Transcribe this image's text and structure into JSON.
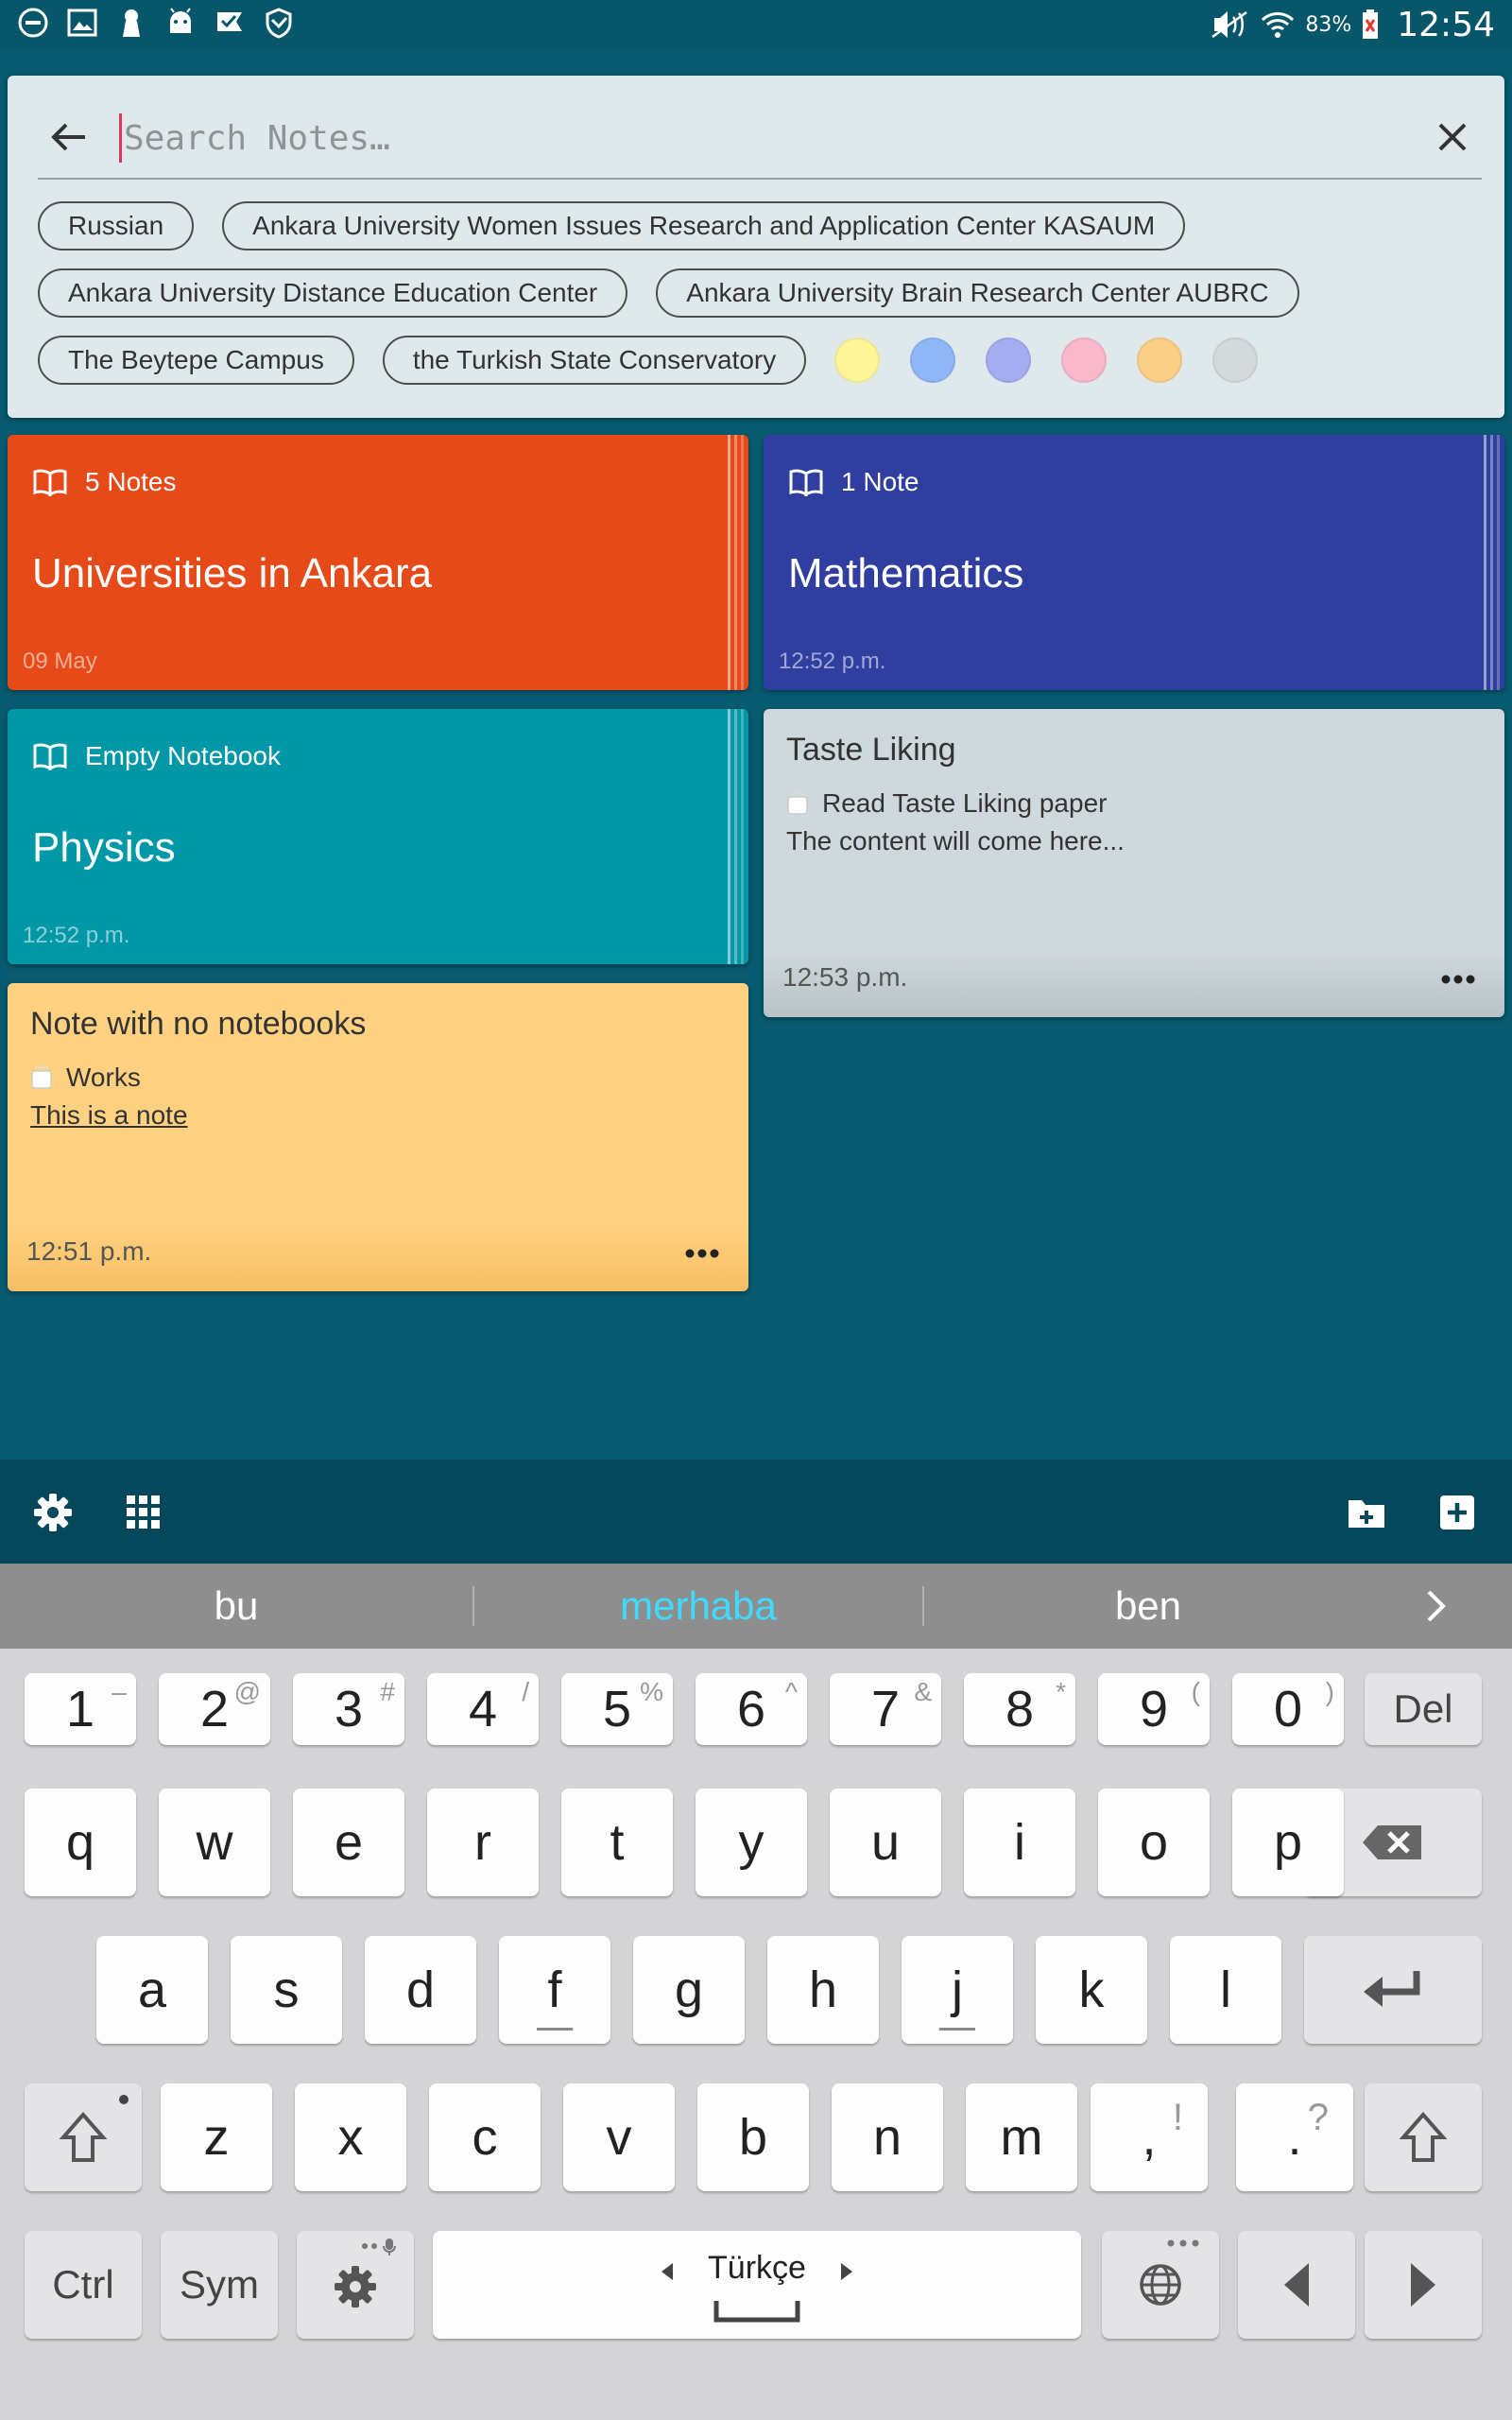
{
  "status_bar": {
    "icons": [
      "dnd-icon",
      "gallery-icon",
      "keyhole-icon",
      "android-icon",
      "check-flag-icon",
      "shield-icon"
    ],
    "battery": "83%",
    "time": "12:54"
  },
  "search": {
    "placeholder": "Search Notes…",
    "value": ""
  },
  "filter_chips": {
    "row1": [
      "Russian",
      "Ankara University Women Issues Research and Application Center KASAUM"
    ],
    "row2": [
      "Ankara University Distance Education Center",
      "Ankara University Brain Research Center AUBRC"
    ],
    "row3": [
      "The Beytepe Campus",
      "the Turkish State Conservatory"
    ]
  },
  "color_filters": [
    "#fdf598",
    "#8fb6f7",
    "#a4adf0",
    "#f9b8cb",
    "#fccf86",
    "#d4d9dc"
  ],
  "notebooks": [
    {
      "count": "5 Notes",
      "title": "Universities in Ankara",
      "date": "09 May",
      "color": "#e64a19"
    },
    {
      "count": "1 Note",
      "title": "Mathematics",
      "date": "12:52 p.m.",
      "color": "#303f9f"
    },
    {
      "count": "Empty Notebook",
      "title": "Physics",
      "date": "12:52 p.m.",
      "color": "#0097a7"
    }
  ],
  "notes": [
    {
      "title": "Taste Liking",
      "checklist": "Read Taste Liking paper",
      "body": "The content will come here...",
      "date": "12:53 p.m.",
      "color": "#cfd8dc"
    },
    {
      "title": "Note with no notebooks",
      "checklist": "Works",
      "body": "This is a note",
      "date": "12:51 p.m.",
      "color": "#ffd180"
    }
  ],
  "suggestions": [
    "bu",
    "merhaba",
    "ben"
  ],
  "keyboard": {
    "numbers": [
      {
        "k": "1",
        "s": "–"
      },
      {
        "k": "2",
        "s": "@"
      },
      {
        "k": "3",
        "s": "#"
      },
      {
        "k": "4",
        "s": "/"
      },
      {
        "k": "5",
        "s": "%"
      },
      {
        "k": "6",
        "s": "^"
      },
      {
        "k": "7",
        "s": "&"
      },
      {
        "k": "8",
        "s": "*"
      },
      {
        "k": "9",
        "s": "("
      },
      {
        "k": "0",
        "s": ")"
      }
    ],
    "del": "Del",
    "row1": [
      "q",
      "w",
      "e",
      "r",
      "t",
      "y",
      "u",
      "i",
      "o",
      "p"
    ],
    "row2": [
      "a",
      "s",
      "d",
      "f",
      "g",
      "h",
      "j",
      "k",
      "l"
    ],
    "row3": [
      "z",
      "x",
      "c",
      "v",
      "b",
      "n",
      "m"
    ],
    "comma": ",",
    "comma_sup": "!",
    "period": ".",
    "period_sup": "?",
    "ctrl": "Ctrl",
    "sym": "Sym",
    "language": "Türkçe"
  }
}
